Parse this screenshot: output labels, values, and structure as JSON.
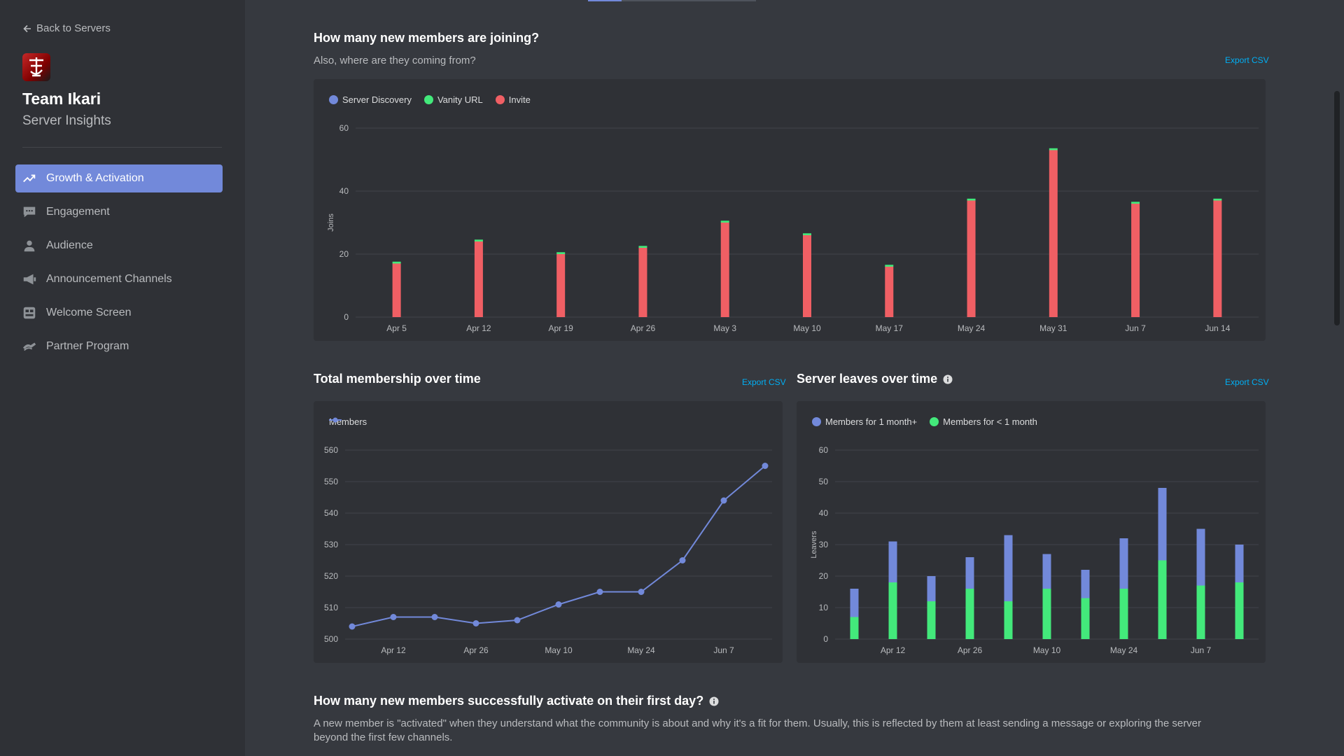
{
  "sidebar": {
    "back_label": "Back to Servers",
    "server_name": "Team Ikari",
    "server_sub": "Server Insights",
    "items": [
      {
        "label": "Growth & Activation",
        "icon": "trending-up-icon"
      },
      {
        "label": "Engagement",
        "icon": "chat-bubble-icon"
      },
      {
        "label": "Audience",
        "icon": "person-icon"
      },
      {
        "label": "Announcement Channels",
        "icon": "megaphone-icon"
      },
      {
        "label": "Welcome Screen",
        "icon": "welcome-screen-icon"
      },
      {
        "label": "Partner Program",
        "icon": "partner-icon"
      }
    ]
  },
  "colors": {
    "discovery": "#7289da",
    "vanity": "#43e97b",
    "invite": "#f05f64",
    "accent": "#7289da",
    "link": "#00aff4"
  },
  "joins": {
    "title": "How many new members are joining?",
    "subtitle": "Also, where are they coming from?",
    "export_label": "Export CSV"
  },
  "membership": {
    "title": "Total membership over time",
    "export_label": "Export CSV"
  },
  "leaves": {
    "title": "Server leaves over time",
    "export_label": "Export CSV"
  },
  "activation": {
    "title": "How many new members successfully activate on their first day?",
    "description": "A new member is \"activated\" when they understand what the community is about and why it's a fit for them. Usually, this is reflected by them at least sending a message or exploring the server beyond the first few channels."
  },
  "chart_data": [
    {
      "type": "bar",
      "stacked": true,
      "ylabel": "Joins",
      "ylim": [
        0,
        60
      ],
      "yticks": [
        0,
        20,
        40,
        60
      ],
      "categories": [
        "Apr 5",
        "Apr 12",
        "Apr 19",
        "Apr 26",
        "May 3",
        "May 10",
        "May 17",
        "May 24",
        "May 31",
        "Jun 7",
        "Jun 14"
      ],
      "series": [
        {
          "name": "Server Discovery",
          "values": [
            0,
            0,
            0,
            0,
            0,
            0,
            0,
            0,
            0,
            0,
            0
          ]
        },
        {
          "name": "Invite",
          "values": [
            17,
            24,
            20,
            22,
            30,
            26,
            16,
            37,
            53,
            36,
            37
          ]
        },
        {
          "name": "Vanity URL",
          "values": [
            0.6,
            0.6,
            0.6,
            0.6,
            0.6,
            0.6,
            0.6,
            0.6,
            0.6,
            0.6,
            0.6
          ]
        }
      ],
      "legend": "top-left",
      "grid": true
    },
    {
      "type": "line",
      "ylim": [
        500,
        560
      ],
      "yticks": [
        500,
        510,
        520,
        530,
        540,
        550,
        560
      ],
      "x": [
        "Apr 5",
        "Apr 12",
        "Apr 19",
        "Apr 26",
        "May 3",
        "May 10",
        "May 17",
        "May 24",
        "May 31",
        "Jun 7",
        "Jun 14"
      ],
      "xticks": [
        "Apr 12",
        "Apr 26",
        "May 10",
        "May 24",
        "Jun 7"
      ],
      "series": [
        {
          "name": "Members",
          "values": [
            504,
            507,
            507,
            505,
            506,
            511,
            515,
            515,
            525,
            544,
            555
          ]
        }
      ],
      "legend": "top-left",
      "grid": true
    },
    {
      "type": "bar",
      "stacked": true,
      "ylabel": "Leavers",
      "ylim": [
        0,
        60
      ],
      "yticks": [
        0,
        10,
        20,
        30,
        40,
        50,
        60
      ],
      "categories": [
        "Apr 5",
        "Apr 12",
        "Apr 19",
        "Apr 26",
        "May 3",
        "May 10",
        "May 17",
        "May 24",
        "May 31",
        "Jun 7",
        "Jun 14"
      ],
      "xticks": [
        "Apr 12",
        "Apr 26",
        "May 10",
        "May 24",
        "Jun 7"
      ],
      "series": [
        {
          "name": "Members for < 1 month",
          "values": [
            7,
            18,
            12,
            16,
            12,
            16,
            13,
            16,
            25,
            17,
            18
          ]
        },
        {
          "name": "Members for 1 month+",
          "values": [
            9,
            13,
            8,
            10,
            21,
            11,
            9,
            16,
            23,
            18,
            12
          ]
        }
      ],
      "legend": "top-left",
      "grid": true
    }
  ]
}
